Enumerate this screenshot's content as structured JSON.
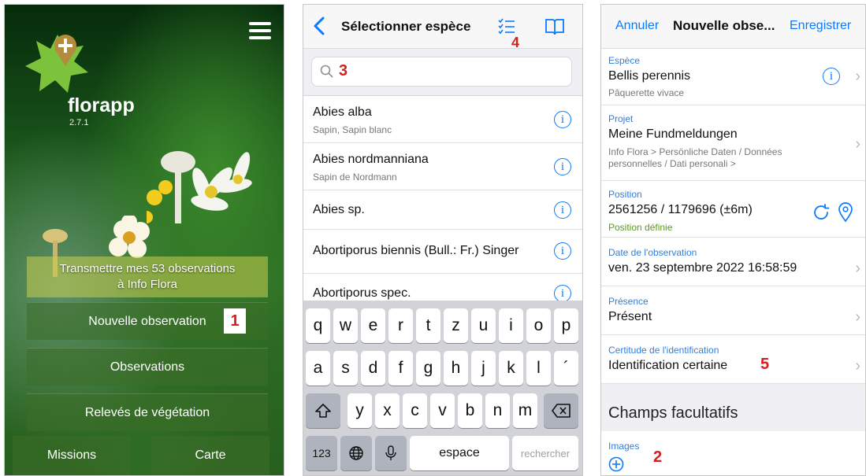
{
  "home": {
    "brand": "florapp",
    "version": "2.7.1",
    "transmit_line1": "Transmettre mes 53 observations",
    "transmit_line2": "à Info Flora",
    "new_observation": "Nouvelle observation",
    "observations": "Observations",
    "vegetation": "Relevés de végétation",
    "missions": "Missions",
    "map": "Carte",
    "marker": "1"
  },
  "species_select": {
    "title": "Sélectionner espèce",
    "search_marker": "3",
    "list_marker": "4",
    "items": [
      {
        "name": "Abies alba",
        "sub": "Sapin, Sapin blanc"
      },
      {
        "name": "Abies nordmanniana",
        "sub": "Sapin de Nordmann"
      },
      {
        "name": "Abies sp.",
        "sub": ""
      },
      {
        "name": "Abortiporus biennis (Bull.: Fr.) Singer",
        "sub": ""
      },
      {
        "name": "Abortiporus spec.",
        "sub": ""
      }
    ],
    "keyboard": {
      "row1": [
        "q",
        "w",
        "e",
        "r",
        "t",
        "z",
        "u",
        "i",
        "o",
        "p"
      ],
      "row2": [
        "a",
        "s",
        "d",
        "f",
        "g",
        "h",
        "j",
        "k",
        "l",
        "´"
      ],
      "row3": [
        "y",
        "x",
        "c",
        "v",
        "b",
        "n",
        "m"
      ],
      "num_key": "123",
      "space_key": "espace",
      "search_key": "rechercher"
    }
  },
  "new_observation": {
    "cancel": "Annuler",
    "title": "Nouvelle obse...",
    "save": "Enregistrer",
    "species_label": "Espèce",
    "species_value": "Bellis perennis",
    "species_sub": "Pâquerette vivace",
    "project_label": "Projet",
    "project_value": "Meine Fundmeldungen",
    "project_sub": "Info Flora > Persönliche Daten / Données personnelles / Dati personali >",
    "position_label": "Position",
    "position_value": "2561256 / 1179696 (±6m)",
    "position_sub": "Position définie",
    "date_label": "Date de l'observation",
    "date_value": "ven. 23 septembre 2022 16:58:59",
    "presence_label": "Présence",
    "presence_value": "Présent",
    "certainty_label": "Certitude de l'identification",
    "certainty_value": "Identification certaine",
    "certainty_marker": "5",
    "optional_header": "Champs facultatifs",
    "images_label": "Images",
    "images_marker": "2"
  },
  "colors": {
    "ios_blue": "#0a7aff",
    "marker_red": "#d21f1f",
    "green_ok": "#5a9a1a"
  }
}
